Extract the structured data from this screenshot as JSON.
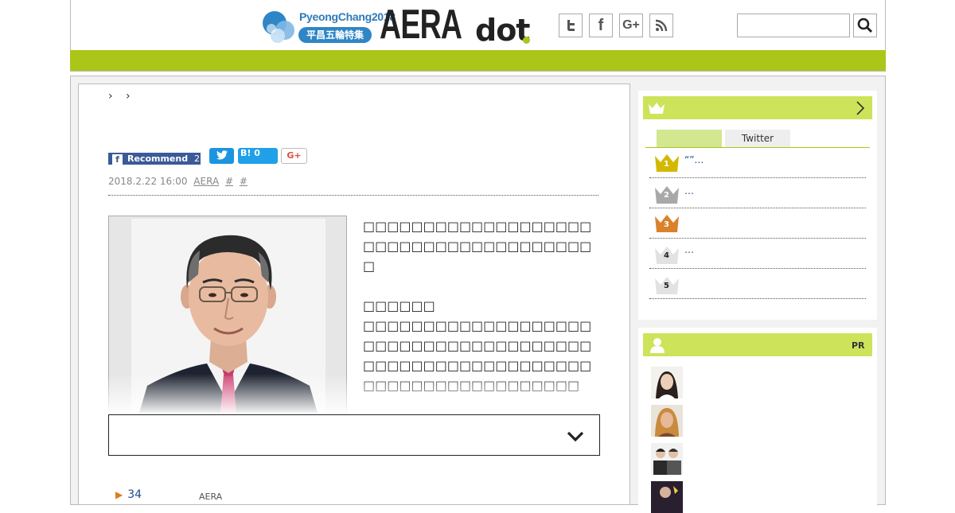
{
  "header": {
    "olympic_title": "PyeongChang2018",
    "olympic_badge": "平昌五輪特集",
    "logo_aera": "AERA",
    "logo_dot": "dot",
    "social": [
      "twitter-icon",
      "facebook-icon",
      "google-plus-icon",
      "rss-icon"
    ],
    "search": {
      "value": "",
      "placeholder": ""
    },
    "colors": {
      "accent_green": "#abc618",
      "olympic_blue": "#2f86c6"
    }
  },
  "article": {
    "breadcrumb": "› ›",
    "share": {
      "fb_label": "Recommend",
      "fb_count": "2",
      "hatena_label": "B!",
      "hatena_count": "0",
      "google_label": "G+"
    },
    "meta": {
      "datetime": "2018.2.22 16:00",
      "source": "AERA",
      "tag1": "#",
      "tag2": "#"
    },
    "para1": "□□□□□□□□□□□□□□□□□□□□□□□□□□□□□□□□□□□□□□□",
    "para2_heading": "□□□□□□",
    "para2": "□□□□□□□□□□□□□□□□□□□□□□□□□□□□□□□□□□□□□□□□□□□□□□□□□□□□□□□□□□□□□□□□□□□□□□□□□□□",
    "more_count": "34",
    "more_source": "AERA"
  },
  "sidebar": {
    "ranking": {
      "tabs": [
        "",
        "Twitter"
      ],
      "items": [
        {
          "rank": "1",
          "text": "“”…"
        },
        {
          "rank": "2",
          "text": "…"
        },
        {
          "rank": "3",
          "text": ""
        },
        {
          "rank": "4",
          "text": "…"
        },
        {
          "rank": "5",
          "text": ""
        }
      ],
      "crown_colors": [
        "#d4b800",
        "#a8a8a8",
        "#d9822b",
        "#cccccc",
        "#cccccc"
      ]
    },
    "pr": {
      "label": "PR"
    }
  }
}
